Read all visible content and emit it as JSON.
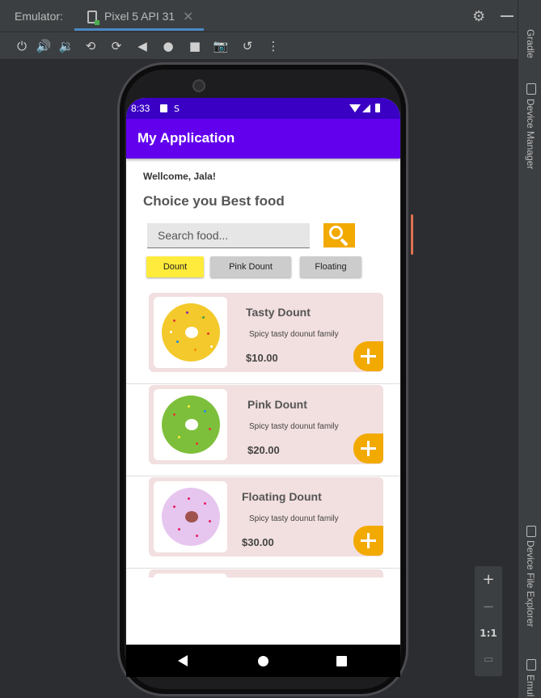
{
  "ide": {
    "emulator_label": "Emulator:",
    "device_tab": "Pixel 5 API 31",
    "tab_close": "×",
    "right_panels": [
      "Gradle",
      "Device Manager",
      "Device File Explorer",
      "Emul"
    ],
    "zoom": {
      "zoom_in": "+",
      "zoom_out": "−",
      "actual_size": "1:1"
    },
    "toolbar_icons": [
      "power-icon",
      "volume-up-icon",
      "volume-down-icon",
      "rotate-left-icon",
      "rotate-right-icon",
      "back-icon",
      "home-icon",
      "overview-icon",
      "screenshot-icon",
      "snapshot-icon",
      "more-icon"
    ]
  },
  "status_bar": {
    "time": "8:33"
  },
  "app": {
    "title": "My Application",
    "welcome": "Wellcome, Jala!",
    "headline": "Choice you Best food",
    "search_placeholder": "Search food...",
    "chips": [
      {
        "label": "Dount",
        "selected": true
      },
      {
        "label": "Pink Dount",
        "selected": false
      },
      {
        "label": "Floating",
        "selected": false
      }
    ],
    "items": [
      {
        "name": "Tasty Dount",
        "description": "Spicy tasty dounut family",
        "price": "$10.00",
        "color": "#f3c92b"
      },
      {
        "name": "Pink Dount",
        "description": "Spicy tasty dounut family",
        "price": "$20.00",
        "color": "#7dbf3a"
      },
      {
        "name": "Floating Dount",
        "description": "Spicy tasty dounut family",
        "price": "$30.00",
        "color": "#e6c6ef"
      }
    ]
  },
  "colors": {
    "app_bar": "#6200ee",
    "status_bar": "#3a00c4",
    "accent": "#f2a900",
    "chip_selected": "#ffeb3b",
    "chip_default": "#cccccc",
    "card": "#f2dfdf"
  }
}
